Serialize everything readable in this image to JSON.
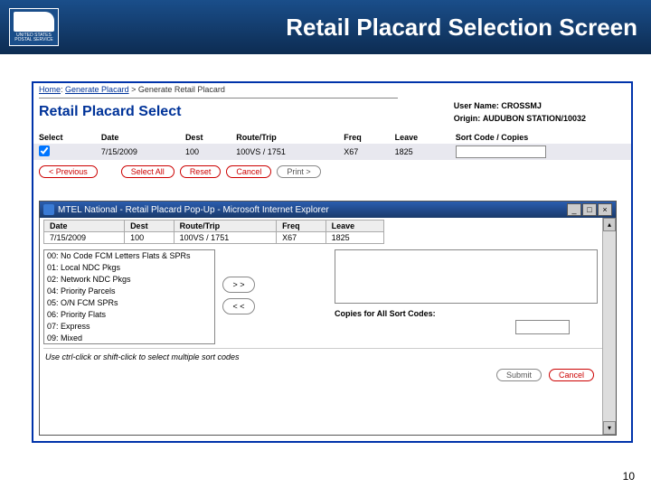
{
  "slide": {
    "logo_line1": "UNITED STATES",
    "logo_line2": "POSTAL SERVICE",
    "title": "Retail Placard Selection Screen",
    "page_number": "10"
  },
  "breadcrumb": {
    "home": "Home",
    "gen": "Generate Placard",
    "current": "Generate Retail Placard"
  },
  "page": {
    "title": "Retail Placard Select",
    "user_label": "User Name:",
    "user_value": "CROSSMJ",
    "origin_label": "Origin:",
    "origin_value": "AUDUBON STATION/10032"
  },
  "table": {
    "headers": [
      "Select",
      "Date",
      "Dest",
      "Route/Trip",
      "Freq",
      "Leave",
      "Sort Code / Copies"
    ],
    "row": {
      "date": "7/15/2009",
      "dest": "100",
      "route": "100VS / 1751",
      "freq": "X67",
      "leave": "1825"
    }
  },
  "buttons": {
    "prev": "< Previous",
    "select_all": "Select All",
    "reset": "Reset",
    "cancel": "Cancel",
    "print": "Print >"
  },
  "popup": {
    "title": "MTEL National - Retail Placard Pop-Up - Microsoft Internet Explorer",
    "headers": [
      "Date",
      "Dest",
      "Route/Trip",
      "Freq",
      "Leave"
    ],
    "row": {
      "date": "7/15/2009",
      "dest": "100",
      "route": "100VS / 1751",
      "freq": "X67",
      "leave": "1825"
    },
    "sort_codes": [
      "00: No Code FCM Letters Flats & SPRs",
      "01: Local NDC Pkgs",
      "02: Network NDC Pkgs",
      "04: Priority Parcels",
      "05: O/N FCM SPRs",
      "06: Priority Flats",
      "07: Express",
      "09: Mixed"
    ],
    "move_in": "> >",
    "move_out": "< <",
    "copies_label": "Copies for All Sort Codes:",
    "hint": "Use ctrl-click or shift-click to select multiple sort codes",
    "submit": "Submit",
    "cancel": "Cancel"
  }
}
